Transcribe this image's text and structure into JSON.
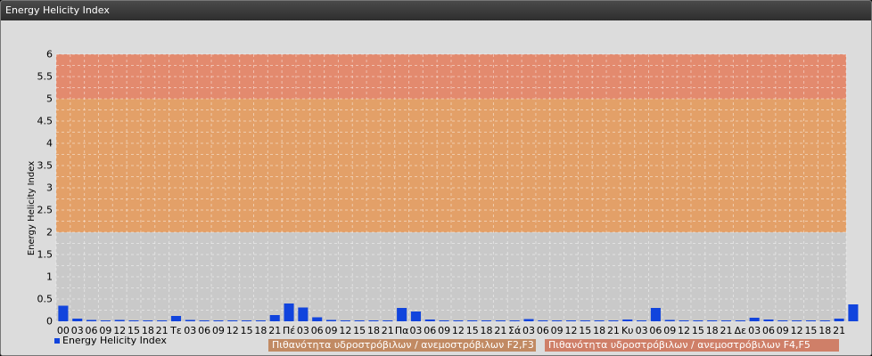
{
  "window": {
    "title": "Energy Helicity Index"
  },
  "colors": {
    "band_low": "#c9c9c9",
    "band_mid": "#e3a068",
    "band_high": "#e38a6e",
    "bar": "#1144dd",
    "legend_mid_bg": "#c18a63",
    "legend_high_bg": "#cf7f68"
  },
  "legend": {
    "series_label": "Energy Helicity Index",
    "band_mid_label": "Πιθανότητα υδροστρόβιλων / ανεμοστρόβιλων F2,F3",
    "band_high_label": "Πιθανότητα υδροστρόβιλων / ανεμοστρόβιλων F4,F5"
  },
  "chart_data": {
    "type": "bar",
    "ylabel": "Energy Helicity Index",
    "xlabel": "",
    "ylim": [
      0,
      6
    ],
    "y_ticks": [
      "0",
      "0.5",
      "1",
      "1.5",
      "2",
      "2.5",
      "3",
      "3.5",
      "4",
      "4.5",
      "5",
      "5.5",
      "6"
    ],
    "bands": [
      {
        "from": 0,
        "to": 2,
        "color_key": "band_low"
      },
      {
        "from": 2,
        "to": 5,
        "color_key": "band_mid"
      },
      {
        "from": 5,
        "to": 6,
        "color_key": "band_high"
      }
    ],
    "categories": [
      "00",
      "03",
      "06",
      "09",
      "12",
      "15",
      "18",
      "21",
      "Τε",
      "03",
      "06",
      "09",
      "12",
      "15",
      "18",
      "21",
      "Πέ",
      "03",
      "06",
      "09",
      "12",
      "15",
      "18",
      "21",
      "Πα",
      "03",
      "06",
      "09",
      "12",
      "15",
      "18",
      "21",
      "Σά",
      "03",
      "06",
      "09",
      "12",
      "15",
      "18",
      "21",
      "Κυ",
      "03",
      "06",
      "09",
      "12",
      "15",
      "18",
      "21",
      "Δε",
      "03",
      "06",
      "09",
      "12",
      "15",
      "18",
      "21"
    ],
    "series": [
      {
        "name": "Energy Helicity Index",
        "values": [
          0.35,
          0.06,
          0.03,
          0.02,
          0.03,
          0.02,
          0.02,
          0.02,
          0.12,
          0.03,
          0.02,
          0.02,
          0.02,
          0.02,
          0.02,
          0.14,
          0.4,
          0.31,
          0.09,
          0.03,
          0.02,
          0.02,
          0.02,
          0.02,
          0.3,
          0.22,
          0.04,
          0.02,
          0.02,
          0.02,
          0.02,
          0.02,
          0.02,
          0.05,
          0.02,
          0.02,
          0.02,
          0.02,
          0.02,
          0.02,
          0.04,
          0.02,
          0.3,
          0.03,
          0.02,
          0.02,
          0.02,
          0.02,
          0.02,
          0.08,
          0.04,
          0.02,
          0.02,
          0.02,
          0.02,
          0.06,
          0.38
        ]
      }
    ],
    "grid": true,
    "legend_position": "bottom-left"
  }
}
